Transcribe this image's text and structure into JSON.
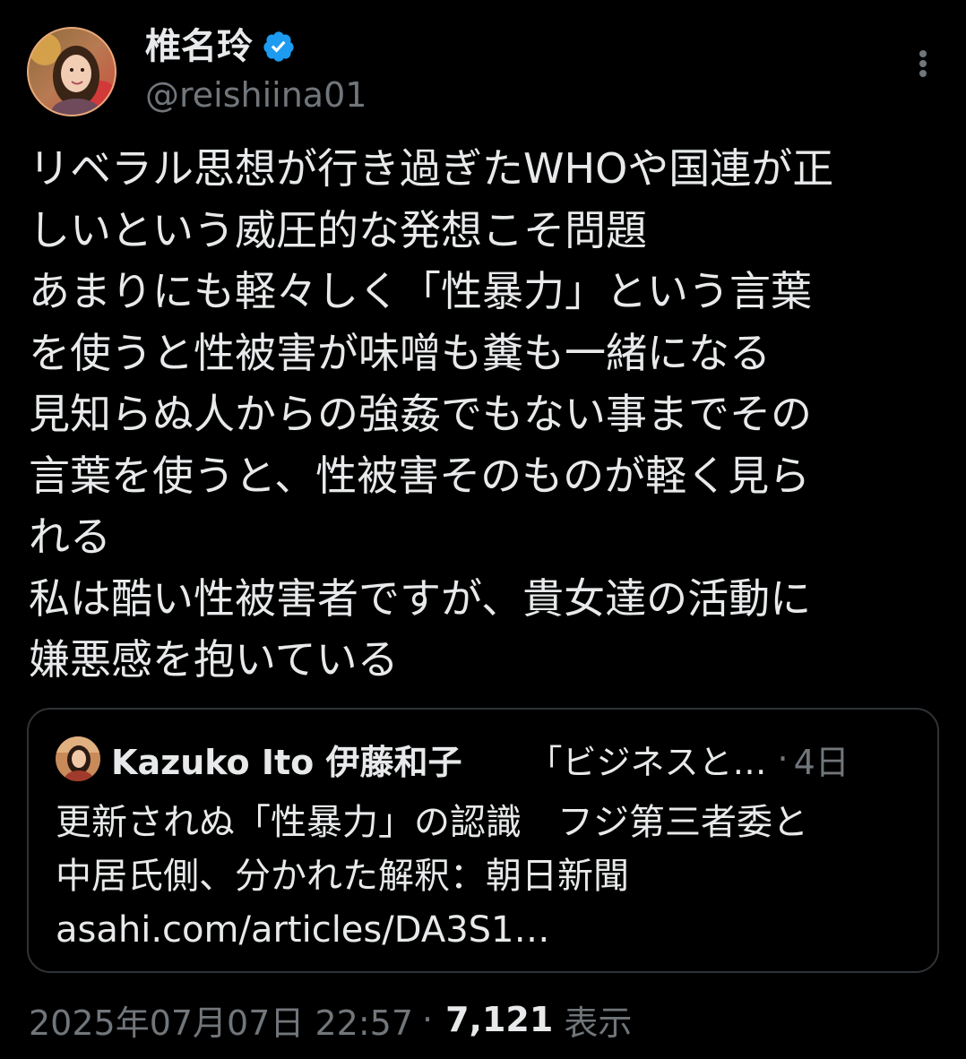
{
  "author": {
    "display_name": "椎名玲",
    "handle": "@reishiina01",
    "verified": true,
    "verified_color": "#1d9bf0"
  },
  "tweet": {
    "lines": [
      "リベラル思想が行き過ぎたWHOや国連が正",
      "しいという威圧的な発想こそ問題",
      "あまりにも軽々しく「性暴力」という言葉",
      "を使うと性被害が味噌も糞も一緒になる",
      "見知らぬ人からの強姦でもない事までその",
      "言葉を使うと、性被害そのものが軽く見ら",
      "れる",
      "私は酷い性被害者ですが、貴女達の活動に",
      "嫌悪感を抱いている"
    ]
  },
  "quote": {
    "author_name": "Kazuko Ito 伊藤和子",
    "author_handle": "「ビジネスと…",
    "separator": "·",
    "time": "4日",
    "lines": [
      "更新されぬ「性暴力」の認識　フジ第三者委と",
      "中居氏側、分かれた解釈：朝日新聞",
      "asahi.com/articles/DA3S1…"
    ]
  },
  "meta": {
    "timestamp": "2025年07月07日 22:57",
    "separator": "·",
    "views_count": "7,121",
    "views_label": "表示"
  },
  "colors": {
    "background": "#000000",
    "text_primary": "#e7e9ea",
    "text_secondary": "#71767b",
    "border": "#2f3336",
    "accent": "#1d9bf0"
  },
  "icons": {
    "verified": "verified-badge-icon",
    "more": "more-dots-icon"
  }
}
